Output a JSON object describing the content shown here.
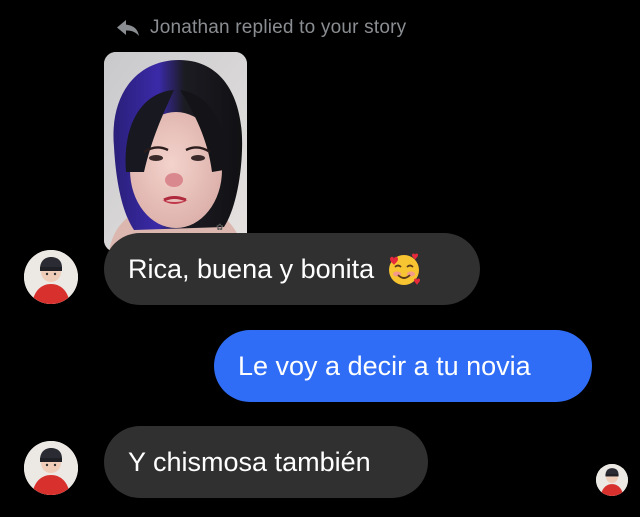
{
  "story_reply": {
    "header_text": "Jonathan replied to your story",
    "icon": "reply-arrow-icon"
  },
  "messages": [
    {
      "direction": "received",
      "text": "Rica, buena y bonita",
      "emoji": "smiling-face-with-hearts"
    },
    {
      "direction": "sent",
      "text": "Le voy a decir a tu novia"
    },
    {
      "direction": "received",
      "text": "Y chismosa también"
    }
  ],
  "colors": {
    "background": "#000000",
    "received_bubble": "#303030",
    "sent_bubble": "#2f6df6",
    "meta_text": "#8a8d91"
  }
}
